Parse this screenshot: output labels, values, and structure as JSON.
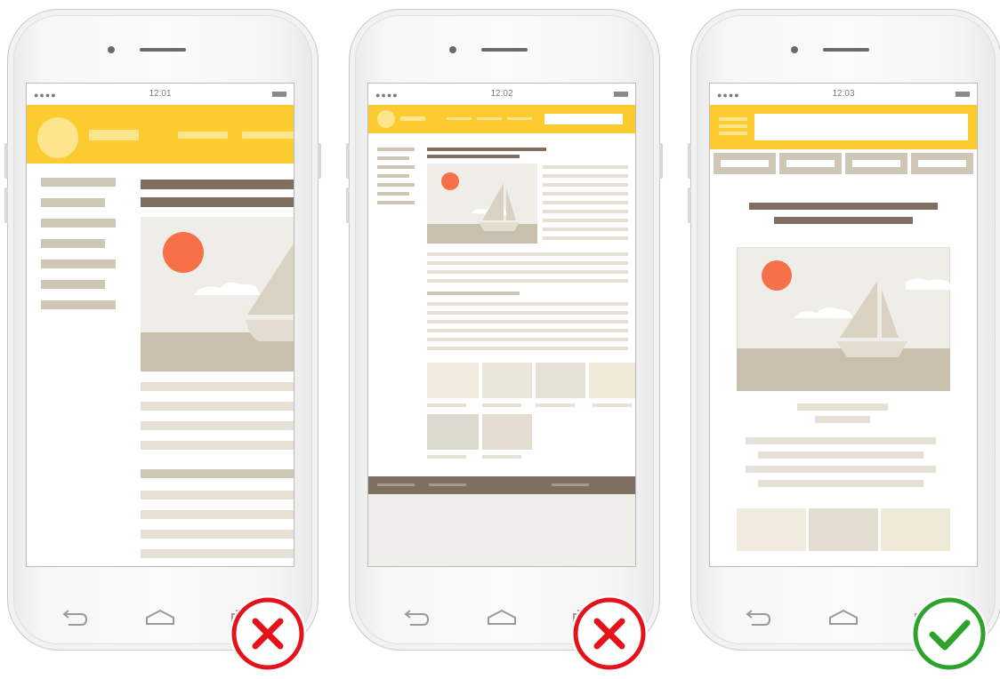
{
  "phones": [
    {
      "time": "12:01",
      "dots": "●●●●",
      "verdict": "bad",
      "badge_color": "#e3121b"
    },
    {
      "time": "12:02",
      "dots": "●●●●",
      "verdict": "bad",
      "badge_color": "#e3121b"
    },
    {
      "time": "12:03",
      "dots": "●●●●",
      "verdict": "good",
      "badge_color": "#2ca32c"
    }
  ],
  "colors": {
    "header": "#fccb30",
    "heading": "#7f6f61",
    "text_lines": "#e6e1d4",
    "sun": "#f7704a",
    "sea": "#c9bfad",
    "sky": "#efede8"
  },
  "icons": [
    "back-icon",
    "home-icon",
    "recents-icon",
    "cross-icon",
    "check-icon",
    "sailboat-image"
  ]
}
